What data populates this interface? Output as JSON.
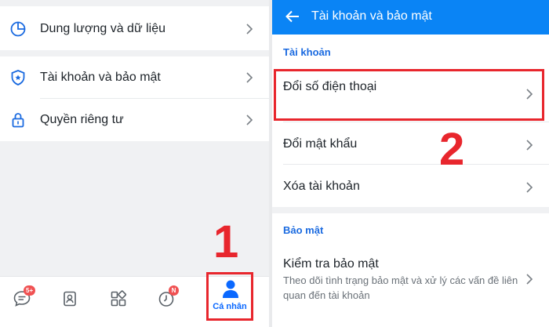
{
  "left": {
    "settings": [
      {
        "label": "Dung lượng và dữ liệu",
        "icon": "pie-chart-icon"
      },
      {
        "label": "Tài khoản và bảo mật",
        "icon": "shield-icon"
      },
      {
        "label": "Quyền riêng tư",
        "icon": "lock-icon"
      }
    ],
    "nav": {
      "messages_badge": "5+",
      "timeline_badge": "N",
      "profile_label": "Cá nhân"
    },
    "step_number": "1"
  },
  "right": {
    "header_title": "Tài khoản và bảo mật",
    "account_section": "Tài khoản",
    "account_items": [
      "Đổi số điện thoại",
      "Đổi mật khẩu",
      "Xóa tài khoản"
    ],
    "security_section": "Bảo mật",
    "security_check": {
      "title": "Kiểm tra bảo mật",
      "description": "Theo dõi tình trạng bảo mật và xử lý các vấn đề liên quan đến tài khoản"
    },
    "step_number": "2"
  },
  "colors": {
    "accent": "#0a84f5",
    "highlight": "#e8262d",
    "badge": "#f05152",
    "section_title": "#1a6ae0"
  }
}
